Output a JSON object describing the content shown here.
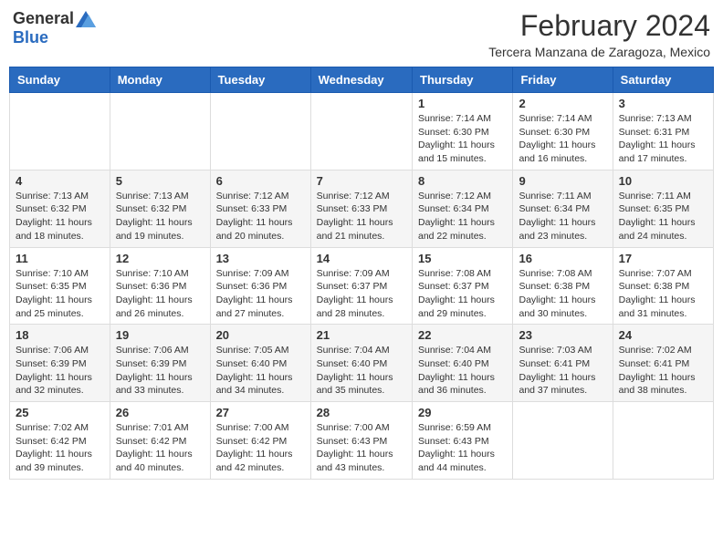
{
  "header": {
    "logo_general": "General",
    "logo_blue": "Blue",
    "month_title": "February 2024",
    "subtitle": "Tercera Manzana de Zaragoza, Mexico"
  },
  "days_of_week": [
    "Sunday",
    "Monday",
    "Tuesday",
    "Wednesday",
    "Thursday",
    "Friday",
    "Saturday"
  ],
  "weeks": [
    [
      {
        "day": "",
        "info": ""
      },
      {
        "day": "",
        "info": ""
      },
      {
        "day": "",
        "info": ""
      },
      {
        "day": "",
        "info": ""
      },
      {
        "day": "1",
        "info": "Sunrise: 7:14 AM\nSunset: 6:30 PM\nDaylight: 11 hours and 15 minutes."
      },
      {
        "day": "2",
        "info": "Sunrise: 7:14 AM\nSunset: 6:30 PM\nDaylight: 11 hours and 16 minutes."
      },
      {
        "day": "3",
        "info": "Sunrise: 7:13 AM\nSunset: 6:31 PM\nDaylight: 11 hours and 17 minutes."
      }
    ],
    [
      {
        "day": "4",
        "info": "Sunrise: 7:13 AM\nSunset: 6:32 PM\nDaylight: 11 hours and 18 minutes."
      },
      {
        "day": "5",
        "info": "Sunrise: 7:13 AM\nSunset: 6:32 PM\nDaylight: 11 hours and 19 minutes."
      },
      {
        "day": "6",
        "info": "Sunrise: 7:12 AM\nSunset: 6:33 PM\nDaylight: 11 hours and 20 minutes."
      },
      {
        "day": "7",
        "info": "Sunrise: 7:12 AM\nSunset: 6:33 PM\nDaylight: 11 hours and 21 minutes."
      },
      {
        "day": "8",
        "info": "Sunrise: 7:12 AM\nSunset: 6:34 PM\nDaylight: 11 hours and 22 minutes."
      },
      {
        "day": "9",
        "info": "Sunrise: 7:11 AM\nSunset: 6:34 PM\nDaylight: 11 hours and 23 minutes."
      },
      {
        "day": "10",
        "info": "Sunrise: 7:11 AM\nSunset: 6:35 PM\nDaylight: 11 hours and 24 minutes."
      }
    ],
    [
      {
        "day": "11",
        "info": "Sunrise: 7:10 AM\nSunset: 6:35 PM\nDaylight: 11 hours and 25 minutes."
      },
      {
        "day": "12",
        "info": "Sunrise: 7:10 AM\nSunset: 6:36 PM\nDaylight: 11 hours and 26 minutes."
      },
      {
        "day": "13",
        "info": "Sunrise: 7:09 AM\nSunset: 6:36 PM\nDaylight: 11 hours and 27 minutes."
      },
      {
        "day": "14",
        "info": "Sunrise: 7:09 AM\nSunset: 6:37 PM\nDaylight: 11 hours and 28 minutes."
      },
      {
        "day": "15",
        "info": "Sunrise: 7:08 AM\nSunset: 6:37 PM\nDaylight: 11 hours and 29 minutes."
      },
      {
        "day": "16",
        "info": "Sunrise: 7:08 AM\nSunset: 6:38 PM\nDaylight: 11 hours and 30 minutes."
      },
      {
        "day": "17",
        "info": "Sunrise: 7:07 AM\nSunset: 6:38 PM\nDaylight: 11 hours and 31 minutes."
      }
    ],
    [
      {
        "day": "18",
        "info": "Sunrise: 7:06 AM\nSunset: 6:39 PM\nDaylight: 11 hours and 32 minutes."
      },
      {
        "day": "19",
        "info": "Sunrise: 7:06 AM\nSunset: 6:39 PM\nDaylight: 11 hours and 33 minutes."
      },
      {
        "day": "20",
        "info": "Sunrise: 7:05 AM\nSunset: 6:40 PM\nDaylight: 11 hours and 34 minutes."
      },
      {
        "day": "21",
        "info": "Sunrise: 7:04 AM\nSunset: 6:40 PM\nDaylight: 11 hours and 35 minutes."
      },
      {
        "day": "22",
        "info": "Sunrise: 7:04 AM\nSunset: 6:40 PM\nDaylight: 11 hours and 36 minutes."
      },
      {
        "day": "23",
        "info": "Sunrise: 7:03 AM\nSunset: 6:41 PM\nDaylight: 11 hours and 37 minutes."
      },
      {
        "day": "24",
        "info": "Sunrise: 7:02 AM\nSunset: 6:41 PM\nDaylight: 11 hours and 38 minutes."
      }
    ],
    [
      {
        "day": "25",
        "info": "Sunrise: 7:02 AM\nSunset: 6:42 PM\nDaylight: 11 hours and 39 minutes."
      },
      {
        "day": "26",
        "info": "Sunrise: 7:01 AM\nSunset: 6:42 PM\nDaylight: 11 hours and 40 minutes."
      },
      {
        "day": "27",
        "info": "Sunrise: 7:00 AM\nSunset: 6:42 PM\nDaylight: 11 hours and 42 minutes."
      },
      {
        "day": "28",
        "info": "Sunrise: 7:00 AM\nSunset: 6:43 PM\nDaylight: 11 hours and 43 minutes."
      },
      {
        "day": "29",
        "info": "Sunrise: 6:59 AM\nSunset: 6:43 PM\nDaylight: 11 hours and 44 minutes."
      },
      {
        "day": "",
        "info": ""
      },
      {
        "day": "",
        "info": ""
      }
    ]
  ]
}
